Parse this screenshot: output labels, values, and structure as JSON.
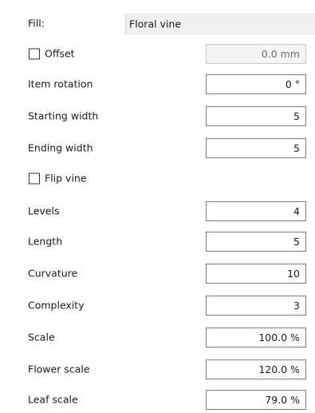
{
  "fill": {
    "label": "Fill:",
    "value": "Floral vine"
  },
  "offset": {
    "label": "Offset",
    "checked": false,
    "value": "0.0 mm"
  },
  "item_rotation": {
    "label": "Item rotation",
    "value": "0 °"
  },
  "starting_width": {
    "label": "Starting width",
    "value": "5"
  },
  "ending_width": {
    "label": "Ending width",
    "value": "5"
  },
  "flip_vine": {
    "label": "Flip vine",
    "checked": false
  },
  "levels": {
    "label": "Levels",
    "value": "4"
  },
  "length": {
    "label": "Length",
    "value": "5"
  },
  "curvature": {
    "label": "Curvature",
    "value": "10"
  },
  "complexity": {
    "label": "Complexity",
    "value": "3"
  },
  "scale": {
    "label": "Scale",
    "value": "100.0 %"
  },
  "flower_scale": {
    "label": "Flower scale",
    "value": "120.0 %"
  },
  "leaf_scale": {
    "label": "Leaf scale",
    "value": "79.0 %"
  }
}
